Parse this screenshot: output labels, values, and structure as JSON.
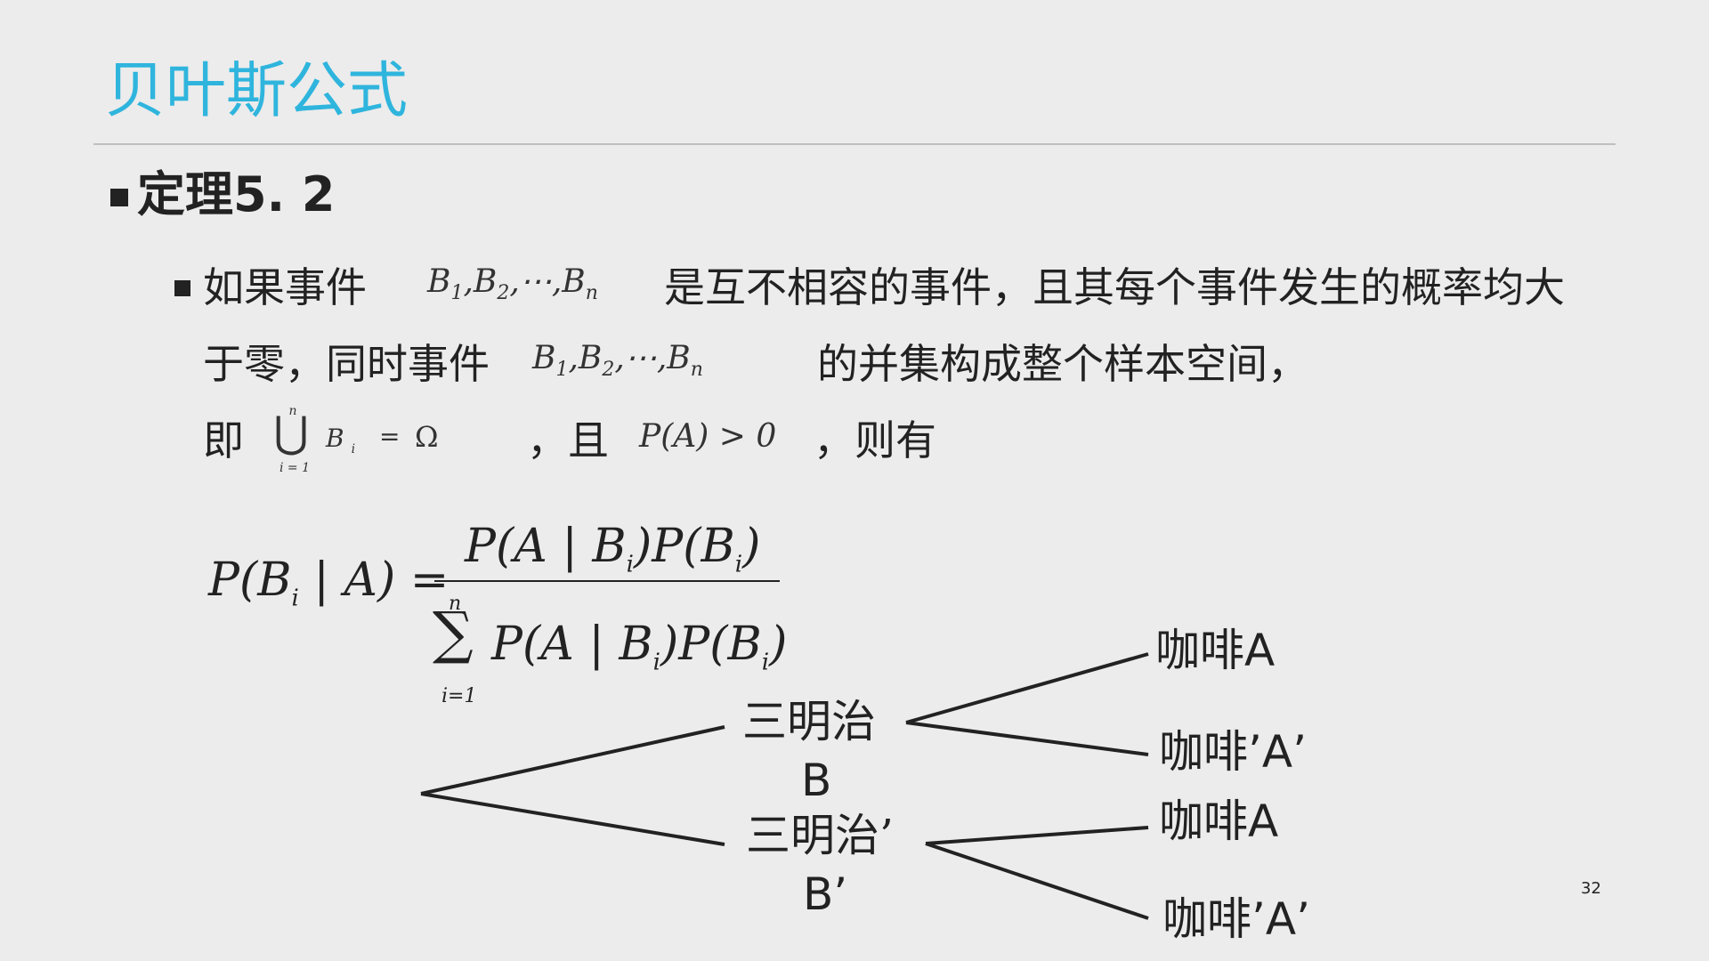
{
  "slide": {
    "title": "贝叶斯公式",
    "heading": "定理5. 2",
    "page_number": "32"
  },
  "paragraph": {
    "line1_a": "如果事件",
    "line1_b": "是互不相容的事件，且其每个事件发生的概率均大",
    "line2_a": "于零，同时事件",
    "line2_b": "的并集构成整个样本空间，",
    "line3_a": "即",
    "line3_b": "，且",
    "line3_c": "，则有"
  },
  "math": {
    "events_B": "B",
    "events_sep": ",",
    "events_dots": "⋯",
    "sub_1": "1",
    "sub_2": "2",
    "sub_n": "n",
    "union_symbol": "⋃",
    "union_upper": "n",
    "union_lower": "i = 1",
    "union_body": "B",
    "union_sub": "i",
    "union_eq": "=",
    "omega": "Ω",
    "pa_condition": "P(A) > 0",
    "formula_lhs": "P(B",
    "formula_lhs_sub": "i",
    "formula_lhs_rest": " | A) =",
    "numerator": "P(A | B",
    "numerator_sub": "i",
    "numerator_mid": ")P(B",
    "numerator_sub2": "i",
    "numerator_end": ")",
    "sum_symbol": "∑",
    "sum_upper": "n",
    "sum_lower": "i=1",
    "denominator": "P(A | B",
    "denominator_sub": "i",
    "denominator_mid": ")P(B",
    "denominator_sub2": "i",
    "denominator_end": ")"
  },
  "tree": {
    "node_b_line1": "三明治",
    "node_b_line2": "B",
    "node_bp_line1": "三明治’",
    "node_bp_line2": "B’",
    "leaf_1": "咖啡A",
    "leaf_2": "咖啡’A’",
    "leaf_3": "咖啡A",
    "leaf_4": "咖啡’A’"
  },
  "colors": {
    "title": "#2fb5dd",
    "background": "#ececec",
    "text": "#222222"
  }
}
